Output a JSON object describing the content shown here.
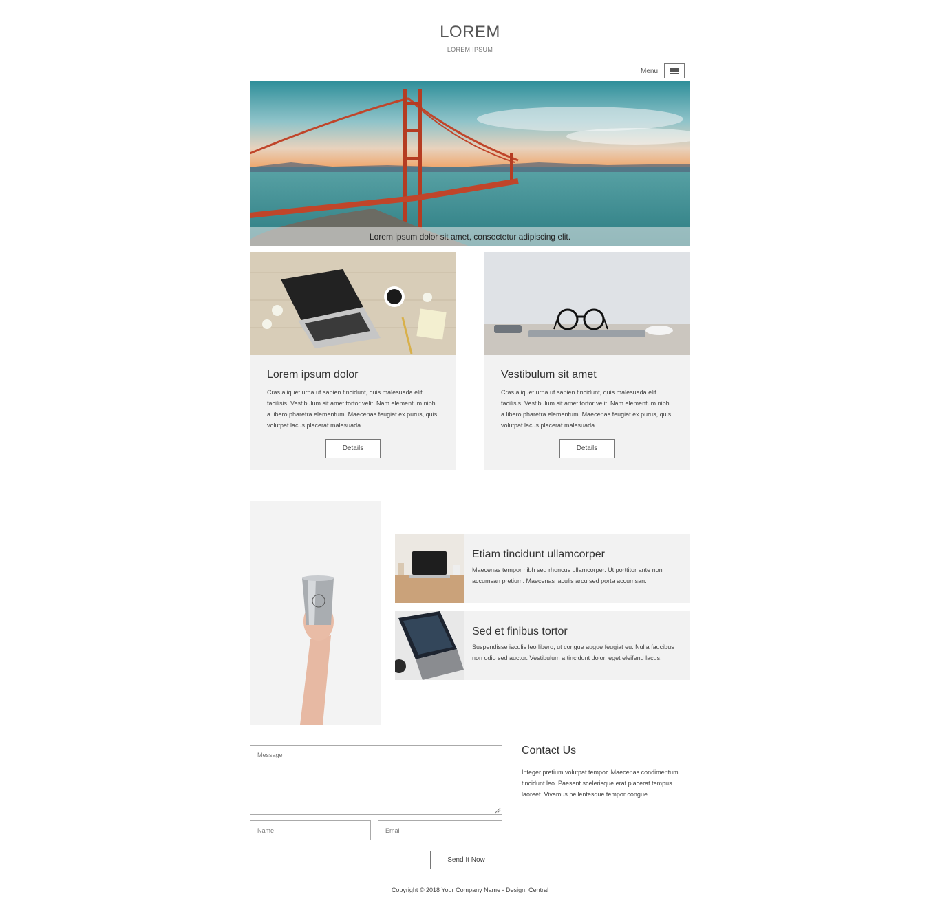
{
  "header": {
    "title": "LOREM",
    "subtitle": "LOREM IPSUM",
    "menu_label": "Menu"
  },
  "hero": {
    "caption": "Lorem ipsum dolor sit amet, consectetur adipiscing elit."
  },
  "cards": [
    {
      "title": "Lorem ipsum dolor",
      "text": "Cras aliquet urna ut sapien tincidunt, quis malesuada elit facilisis. Vestibulum sit amet tortor velit. Nam elementum nibh a libero pharetra elementum. Maecenas feugiat ex purus, quis volutpat lacus placerat malesuada.",
      "button": "Details"
    },
    {
      "title": "Vestibulum sit amet",
      "text": "Cras aliquet urna ut sapien tincidunt, quis malesuada elit facilisis. Vestibulum sit amet tortor velit. Nam elementum nibh a libero pharetra elementum. Maecenas feugiat ex purus, quis volutpat lacus placerat malesuada.",
      "button": "Details"
    }
  ],
  "features": [
    {
      "title": "Etiam tincidunt ullamcorper",
      "text": "Maecenas tempor nibh sed rhoncus ullamcorper. Ut porttitor ante non accumsan pretium. Maecenas iaculis arcu sed porta accumsan."
    },
    {
      "title": "Sed et finibus tortor",
      "text": "Suspendisse iaculis leo libero, ut congue augue feugiat eu. Nulla faucibus non odio sed auctor. Vestibulum a tincidunt dolor, eget eleifend lacus."
    }
  ],
  "form": {
    "message_placeholder": "Message",
    "name_placeholder": "Name",
    "email_placeholder": "Email",
    "send_label": "Send It Now"
  },
  "contact": {
    "title": "Contact Us",
    "text": "Integer pretium volutpat tempor. Maecenas condimentum tincidunt leo. Paesent scelerisque erat placerat tempus laoreet. Vivamus pellentesque tempor congue."
  },
  "footer": {
    "copyright": "Copyright © 2018 Your Company Name - Design: Central"
  }
}
